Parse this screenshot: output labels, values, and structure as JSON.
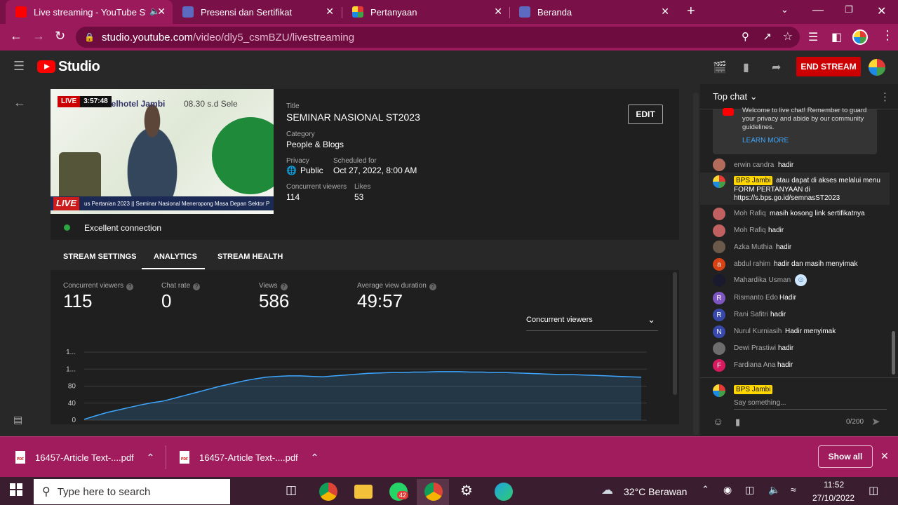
{
  "browser": {
    "tabs": [
      {
        "title": "Live streaming - YouTube St...",
        "active": true
      },
      {
        "title": "Presensi dan Sertifikat"
      },
      {
        "title": "Pertanyaan"
      },
      {
        "title": "Beranda"
      }
    ],
    "new_tab": "+",
    "url_host": "studio.youtube.com",
    "url_path": "/video/dly5_csmBZU/livestreaming"
  },
  "studio": {
    "brand": "Studio",
    "end_stream_label": "END STREAM"
  },
  "stream": {
    "live_label": "LIVE",
    "elapsed": "3:57:48",
    "venue_text": "Belhotel Jambi",
    "time_text": "08.30 s.d Sele",
    "banner_text": "us Pertanian 2023 || Seminar Nasional Meneropong Masa Depan Sektor P",
    "banner_live": "LIVE",
    "title_label": "Title",
    "title": "SEMINAR NASIONAL ST2023",
    "category_label": "Category",
    "category": "People & Blogs",
    "privacy_label": "Privacy",
    "privacy": "Public",
    "scheduled_label": "Scheduled for",
    "scheduled": "Oct 27, 2022, 8:00 AM",
    "viewers_label": "Concurrent viewers",
    "viewers": "114",
    "likes_label": "Likes",
    "likes": "53",
    "edit_label": "EDIT",
    "connection": "Excellent connection"
  },
  "tabs": [
    "STREAM SETTINGS",
    "ANALYTICS",
    "STREAM HEALTH"
  ],
  "metrics": [
    {
      "label": "Concurrent viewers",
      "value": "115"
    },
    {
      "label": "Chat rate",
      "value": "0"
    },
    {
      "label": "Views",
      "value": "586"
    },
    {
      "label": "Average view duration",
      "value": "49:57"
    }
  ],
  "metric_select": "Concurrent viewers",
  "chart_data": {
    "type": "area",
    "series": [
      {
        "values": [
          2,
          10,
          18,
          24,
          30,
          36,
          41,
          45,
          52,
          59,
          66,
          73,
          80,
          86,
          92,
          97,
          101,
          103,
          104,
          104,
          103,
          102,
          104,
          106,
          108,
          110,
          111,
          112,
          112,
          113,
          113,
          114,
          114,
          114,
          113,
          113,
          112,
          112,
          111,
          110,
          109,
          108,
          107,
          107,
          106,
          105,
          104,
          103,
          102,
          101
        ]
      }
    ],
    "ylim": [
      0,
      160
    ],
    "yticks": [
      "0",
      "40",
      "80",
      "1...",
      "1..."
    ],
    "grid": true,
    "color": "#3ea6ff"
  },
  "chat": {
    "header": "Top chat",
    "welcome_text": "Welcome to live chat! Remember to guard your privacy and abide by our community guidelines.",
    "learn_more": "LEARN MORE",
    "messages": [
      {
        "name": "erwin candra",
        "text": "hadir",
        "initial": "",
        "color": "#b36b5b"
      },
      {
        "name": "BPS Jambi",
        "text": "atau dapat di akses melalui menu FORM PERTANYAAN di https://s.bps.go.id/semnasST2023",
        "owner": true
      },
      {
        "name": "Moh Rafiq",
        "text": "masih kosong link sertifikatnya",
        "initial": "",
        "color": "#c06060"
      },
      {
        "name": "Moh Rafiq",
        "text": "hadir",
        "initial": "",
        "color": "#c06060"
      },
      {
        "name": "Azka Muthia",
        "text": "hadir",
        "initial": "",
        "color": "#6b5a4a"
      },
      {
        "name": "abdul rahim",
        "text": "hadir dan masih menyimak",
        "initial": "a",
        "color": "#d84315"
      },
      {
        "name": "Mahardika Usman",
        "text": "",
        "initial": "",
        "color": "#1a1a2e"
      },
      {
        "name": "Rismanto Edo",
        "text": "Hadir",
        "initial": "R",
        "color": "#7e57c2"
      },
      {
        "name": "Rani Safitri",
        "text": "hadir",
        "initial": "R",
        "color": "#3949ab"
      },
      {
        "name": "Nurul Kurniasih",
        "text": "Hadir menyimak",
        "initial": "N",
        "color": "#3949ab"
      },
      {
        "name": "Dewi Prastiwi",
        "text": "hadir",
        "initial": "",
        "color": "#6d6d6d"
      },
      {
        "name": "Fardiana Ana",
        "text": "hadir",
        "initial": "F",
        "color": "#d81b60"
      }
    ],
    "input_owner": "BPS Jambi",
    "input_placeholder": "Say something...",
    "counter": "0/200"
  },
  "downloads": {
    "items": [
      {
        "name": "16457-Article Text-....pdf"
      },
      {
        "name": "16457-Article Text-....pdf"
      }
    ],
    "pdf_icon_text": "PDF",
    "show_all": "Show all"
  },
  "taskbar": {
    "search_placeholder": "Type here to search",
    "whatsapp_badge": "42",
    "weather": "32°C  Berawan",
    "time": "11:52",
    "date": "27/10/2022"
  }
}
